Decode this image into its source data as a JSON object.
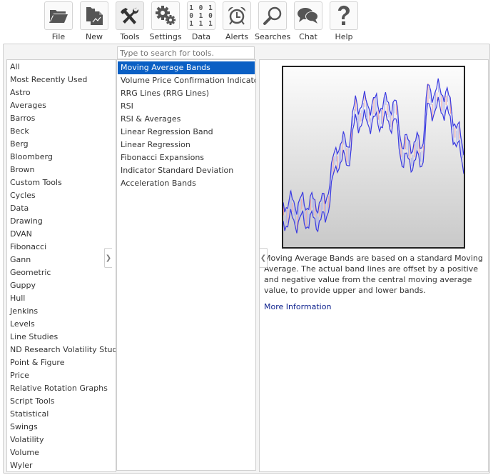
{
  "toolbar": {
    "buttons": [
      {
        "id": "file",
        "label": "File",
        "icon": "folder-icon"
      },
      {
        "id": "new",
        "label": "New",
        "icon": "new-chart-icon"
      },
      {
        "id": "tools",
        "label": "Tools",
        "icon": "tools-icon",
        "active": true
      },
      {
        "id": "settings",
        "label": "Settings",
        "icon": "gears-icon"
      },
      {
        "id": "data",
        "label": "Data",
        "icon": "binary-data-icon",
        "binary": [
          "1 0 1",
          "0 1 0",
          "1 1 1"
        ]
      },
      {
        "id": "alerts",
        "label": "Alerts",
        "icon": "alarm-clock-icon"
      },
      {
        "id": "searches",
        "label": "Searches",
        "icon": "magnifier-icon"
      },
      {
        "id": "chat",
        "label": "Chat",
        "icon": "chat-bubbles-icon"
      },
      {
        "id": "help",
        "label": "Help",
        "icon": "question-mark-icon"
      }
    ]
  },
  "categories": {
    "items": [
      "All",
      "Most Recently Used",
      "Astro",
      "Averages",
      "Barros",
      "Beck",
      "Berg",
      "Bloomberg",
      "Brown",
      "Custom Tools",
      "Cycles",
      "Data",
      "Drawing",
      "DVAN",
      "Fibonacci",
      "Gann",
      "Geometric",
      "Guppy",
      "Hull",
      "Jenkins",
      "Levels",
      "Line Studies",
      "ND Research Volatility Studi",
      "Point & Figure",
      "Price",
      "Relative Rotation Graphs",
      "Script Tools",
      "Statistical",
      "Swings",
      "Volatility",
      "Volume",
      "Wyler"
    ]
  },
  "search": {
    "placeholder": "Type to search for tools.",
    "value": ""
  },
  "tools": {
    "selected": "Moving Average Bands",
    "items": [
      "Moving Average Bands",
      "Volume Price Confirmation Indicator",
      "RRG Lines (RRG Lines)",
      "RSI",
      "RSI & Averages",
      "Linear Regression Band",
      "Linear Regression",
      "Fibonacci Expansions",
      "Indicator Standard Deviation",
      "Acceleration Bands"
    ]
  },
  "description": {
    "text": "Moving Average Bands are based on a standard Moving Average. The actual band lines are offset by a positive and negative value from the central moving average value, to provide upper and lower bands.",
    "link": "More Information",
    "band_color": "#3a3ae0",
    "up_bar_color": "#aab0ee",
    "down_bar_color": "#f0a0a0"
  },
  "colors": {
    "selection": "#0a5fc4",
    "link": "#0a1e8c"
  }
}
